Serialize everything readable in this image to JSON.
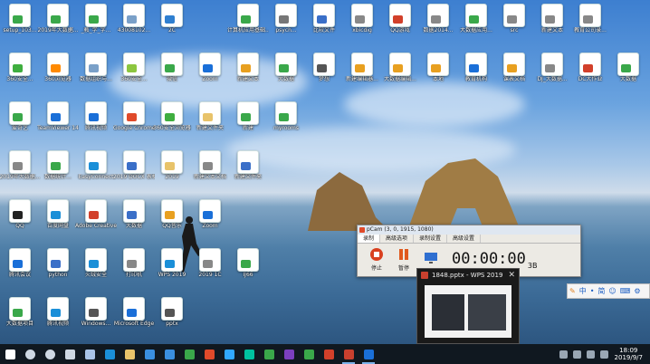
{
  "desktop_icons": [
    {
      "label": "setup_103...",
      "color": "#3aa84a"
    },
    {
      "label": "2019年大数据...",
      "color": "#3aa84a"
    },
    {
      "label": "_教_学_字...",
      "color": "#3aa84a"
    },
    {
      "label": "43008102...",
      "color": "#7aa0c8"
    },
    {
      "label": "2C",
      "color": "#2f7fd0"
    },
    {
      "label": "计算机应用基础...",
      "color": "#3aa84a"
    },
    {
      "label": "psych...",
      "color": "#777"
    },
    {
      "label": "比较文件",
      "color": "#3a6fc8"
    },
    {
      "label": "xblcdig",
      "color": "#888"
    },
    {
      "label": "QQ游戏",
      "color": "#d2402a"
    },
    {
      "label": "数据2014...",
      "color": "#888"
    },
    {
      "label": "大数据应用...",
      "color": "#3aa84a"
    },
    {
      "label": "src",
      "color": "#888"
    },
    {
      "label": "新建文本",
      "color": "#888"
    },
    {
      "label": "教育公司录...",
      "color": "#888"
    },
    {
      "label": "360安全...",
      "color": "#3fae3f"
    },
    {
      "label": "360浏览器",
      "color": "#ff8a00"
    },
    {
      "label": "数据组织与...",
      "color": "#7aa0c8"
    },
    {
      "label": "360安全...",
      "color": "#8cc63f"
    },
    {
      "label": "微信",
      "color": "#3aa84a"
    },
    {
      "label": "Zoom",
      "color": "#1a6fd8"
    },
    {
      "label": "新建文本",
      "color": "#e8a020"
    },
    {
      "label": "大数据",
      "color": "#3aa84a"
    },
    {
      "label": "梦想",
      "color": "#555"
    },
    {
      "label": "新建编辑器...",
      "color": "#e8a020"
    },
    {
      "label": "大数据编辑...",
      "color": "#e8a020"
    },
    {
      "label": "本地",
      "color": "#e8a020"
    },
    {
      "label": "教育机构",
      "color": "#1a6fd8"
    },
    {
      "label": "课表文档",
      "color": "#e8a020"
    },
    {
      "label": "DJ_大数据...",
      "color": "#888"
    },
    {
      "label": "DC大作业",
      "color": "#d2402a"
    },
    {
      "label": "大数据",
      "color": "#3aa84a"
    },
    {
      "label": "爱奇艺",
      "color": "#3aa84a"
    },
    {
      "label": "TeamViewer 14",
      "color": "#1a6fd8"
    },
    {
      "label": "腾讯视频",
      "color": "#1a6fd8"
    },
    {
      "label": "Google Chrome",
      "color": "#e04a2a"
    },
    {
      "label": "360安全浏览器",
      "color": "#3fae3f"
    },
    {
      "label": "新建文件夹",
      "color": "#e8c36a"
    },
    {
      "label": "新建",
      "color": "#3aa84a"
    },
    {
      "label": "myrooms",
      "color": "#3aa84a"
    },
    {
      "label": "2019年大数据...",
      "color": "#888"
    },
    {
      "label": "数据统计...",
      "color": "#3aa84a"
    },
    {
      "label": "EasyConnect",
      "color": "#1a8fd8"
    },
    {
      "label": "2019 DOCX 表格",
      "color": "#3a6fc8"
    },
    {
      "label": "2019",
      "color": "#e8c36a"
    },
    {
      "label": "新建文本文档",
      "color": "#888"
    },
    {
      "label": "新建文件夹",
      "color": "#3a6fc8"
    },
    {
      "label": "QQ",
      "color": "#222"
    },
    {
      "label": "百度网盘",
      "color": "#1a8fd8"
    },
    {
      "label": "Adobe Creative...",
      "color": "#d2402a"
    },
    {
      "label": "大数据",
      "color": "#3a6fc8"
    },
    {
      "label": "QQ音乐",
      "color": "#e8a020"
    },
    {
      "label": "Zoom",
      "color": "#1a6fd8"
    },
    {
      "label": "腾讯会议",
      "color": "#1a6fd8"
    },
    {
      "label": "python",
      "color": "#3a6fc8"
    },
    {
      "label": "火绒安全",
      "color": "#1a8fd8"
    },
    {
      "label": "打印机",
      "color": "#888"
    },
    {
      "label": "WPS 2019",
      "color": "#1a8fd8"
    },
    {
      "label": "2019 1C",
      "color": "#888"
    },
    {
      "label": "IJ66",
      "color": "#3aa84a"
    },
    {
      "label": "大数据项目",
      "color": "#3aa84a"
    },
    {
      "label": "腾讯视频",
      "color": "#1a8fd8"
    },
    {
      "label": "Windows...",
      "color": "#555"
    },
    {
      "label": "Microsoft Edge",
      "color": "#1a6fd8"
    },
    {
      "label": "pptx",
      "color": "#555"
    }
  ],
  "pcam": {
    "title": "pCam (3, 0, 1915, 1080)",
    "tabs": [
      "录制",
      "高级选项",
      "录制设置",
      "高级设置"
    ],
    "stop_label": "停止",
    "pause_label": "暂停",
    "timer": "00:00:00",
    "size": "3B"
  },
  "wps_preview": {
    "title": "1848.pptx - WPS 2019",
    "close": "✕"
  },
  "ime": {
    "items": [
      "中",
      "•",
      "简",
      "☺",
      "⌨",
      "⚙"
    ]
  },
  "taskbar": {
    "clock_time": "18:09",
    "clock_date": "2019/9/7",
    "apps": [
      {
        "name": "start",
        "color": "#ffffff"
      },
      {
        "name": "search",
        "color": "#cfd8e3"
      },
      {
        "name": "cortana",
        "color": "#cfd8e3"
      },
      {
        "name": "task-view",
        "color": "#cfd8e3"
      },
      {
        "name": "app",
        "color": "#a9c4e8"
      },
      {
        "name": "edge",
        "color": "#1a8fd8"
      },
      {
        "name": "explorer",
        "color": "#e8c36a"
      },
      {
        "name": "store",
        "color": "#3a8fe0"
      },
      {
        "name": "mail",
        "color": "#3a8fe0"
      },
      {
        "name": "wps",
        "color": "#3aa84a"
      },
      {
        "name": "chrome",
        "color": "#e04a2a"
      },
      {
        "name": "photoshop",
        "color": "#31a8ff"
      },
      {
        "name": "audition",
        "color": "#00c2a0"
      },
      {
        "name": "wechat",
        "color": "#3aa84a"
      },
      {
        "name": "onenote",
        "color": "#7b3fbf"
      },
      {
        "name": "sheets",
        "color": "#3aa84a"
      },
      {
        "name": "pdf",
        "color": "#d2402a"
      },
      {
        "name": "pptx",
        "color": "#c9402e"
      },
      {
        "name": "wps-writer",
        "color": "#1a6fd8"
      }
    ]
  }
}
